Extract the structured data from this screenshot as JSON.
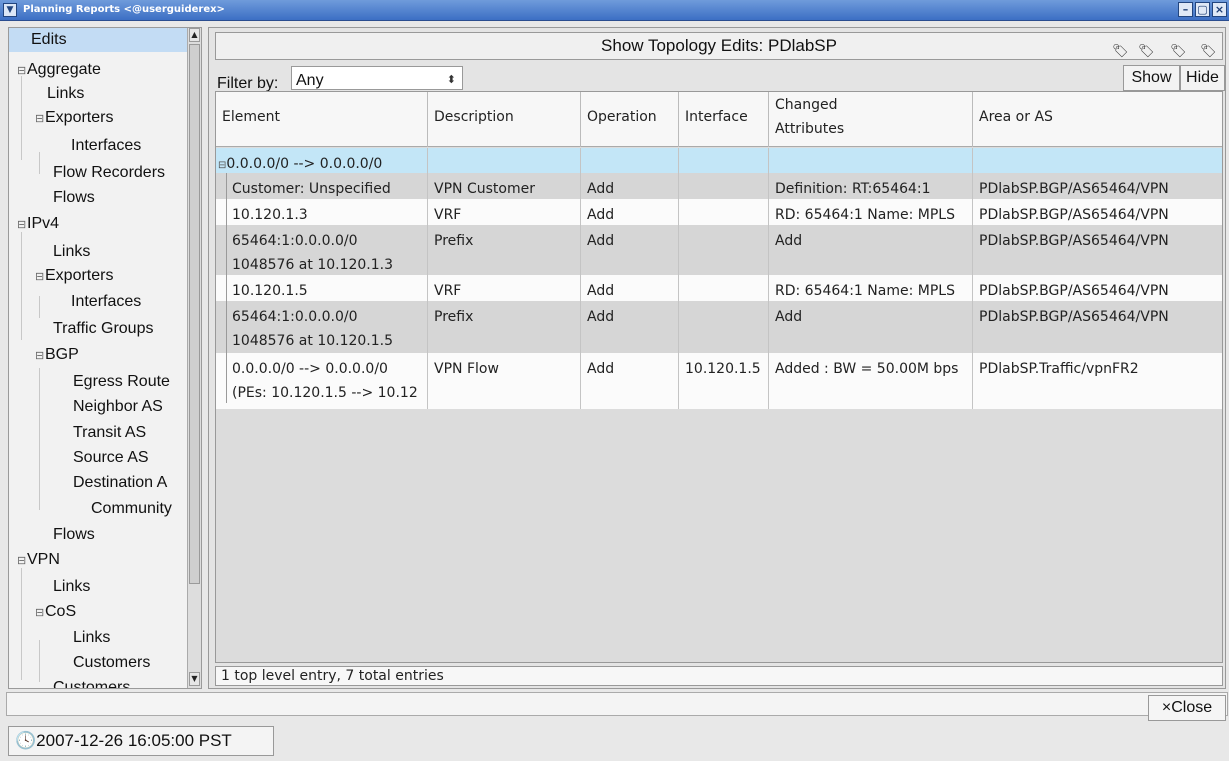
{
  "window": {
    "title": "Planning Reports <@userguiderex>",
    "minimize": "–",
    "maximize": "▢",
    "close": "×"
  },
  "sidebar": {
    "items": [
      {
        "label": "Edits",
        "level": 0,
        "selected": true
      },
      {
        "label": "Aggregate",
        "level": 0,
        "expanded": true
      },
      {
        "label": "Links",
        "level": 1
      },
      {
        "label": "Exporters",
        "level": 1,
        "expanded": true
      },
      {
        "label": "Interfaces",
        "level": 2
      },
      {
        "label": "Flow Recorders",
        "level": 1
      },
      {
        "label": "Flows",
        "level": 1
      },
      {
        "label": "IPv4",
        "level": 0,
        "expanded": true
      },
      {
        "label": "Links",
        "level": 1
      },
      {
        "label": "Exporters",
        "level": 1,
        "expanded": true
      },
      {
        "label": "Interfaces",
        "level": 2
      },
      {
        "label": "Traffic Groups",
        "level": 1
      },
      {
        "label": "BGP",
        "level": 1,
        "expanded": true
      },
      {
        "label": "Egress Route",
        "level": 2
      },
      {
        "label": "Neighbor AS",
        "level": 2
      },
      {
        "label": "Transit AS",
        "level": 2
      },
      {
        "label": "Source AS",
        "level": 2
      },
      {
        "label": "Destination A",
        "level": 2
      },
      {
        "label": "Community",
        "level": 2
      },
      {
        "label": "Flows",
        "level": 1
      },
      {
        "label": "VPN",
        "level": 0,
        "expanded": true
      },
      {
        "label": "Links",
        "level": 1
      },
      {
        "label": "CoS",
        "level": 1,
        "expanded": true
      },
      {
        "label": "Links",
        "level": 2
      },
      {
        "label": "Customers",
        "level": 2
      },
      {
        "label": "Customers",
        "level": 1
      }
    ]
  },
  "panel": {
    "title": "Show Topology Edits: PDlabSP",
    "filter_label": "Filter by:",
    "filter_value": "Any",
    "show_label": "Show",
    "hide_label": "Hide"
  },
  "table": {
    "columns": [
      "Element",
      "Description",
      "Operation",
      "Interface",
      "Changed\nAttributes",
      "Area or AS"
    ],
    "col_changed_1": "Changed",
    "col_changed_2": "Attributes",
    "rows": [
      {
        "element": "0.0.0.0/0 --> 0.0.0.0/0",
        "element2": "",
        "description": "",
        "operation": "",
        "interface": "",
        "changed": "",
        "area": ""
      },
      {
        "element": "Customer: Unspecified",
        "element2": "",
        "description": "VPN Customer",
        "operation": "Add",
        "interface": "",
        "changed": "Definition: RT:65464:1",
        "area": "PDlabSP.BGP/AS65464/VPN"
      },
      {
        "element": "10.120.1.3",
        "element2": "",
        "description": "VRF",
        "operation": "Add",
        "interface": "",
        "changed": "RD: 65464:1 Name:  MPLS",
        "area": "PDlabSP.BGP/AS65464/VPN"
      },
      {
        "element": "65464:1:0.0.0.0/0",
        "element2": "1048576 at 10.120.1.3",
        "description": "Prefix",
        "operation": "Add",
        "interface": "",
        "changed": "Add",
        "area": "PDlabSP.BGP/AS65464/VPN"
      },
      {
        "element": "10.120.1.5",
        "element2": "",
        "description": "VRF",
        "operation": "Add",
        "interface": "",
        "changed": "RD: 65464:1 Name:  MPLS",
        "area": "PDlabSP.BGP/AS65464/VPN"
      },
      {
        "element": "65464:1:0.0.0.0/0",
        "element2": "1048576 at 10.120.1.5",
        "description": "Prefix",
        "operation": "Add",
        "interface": "",
        "changed": "Add",
        "area": "PDlabSP.BGP/AS65464/VPN"
      },
      {
        "element": "0.0.0.0/0 --> 0.0.0.0/0",
        "element2": "(PEs: 10.120.1.5 --> 10.12",
        "description": "VPN Flow",
        "operation": "Add",
        "interface": "10.120.1.5",
        "changed": "Added : BW = 50.00M bps",
        "area": "PDlabSP.Traffic/vpnFR2"
      }
    ]
  },
  "status": "1 top level entry, 7 total entries",
  "close_label": "Close",
  "timestamp": "2007-12-26 16:05:00 PST",
  "icons": {
    "toolbar": [
      "edit-tag-icon",
      "edit-tag-icon",
      "edit-tag-icon",
      "edit-tag-icon"
    ],
    "clock": "clock-icon"
  }
}
